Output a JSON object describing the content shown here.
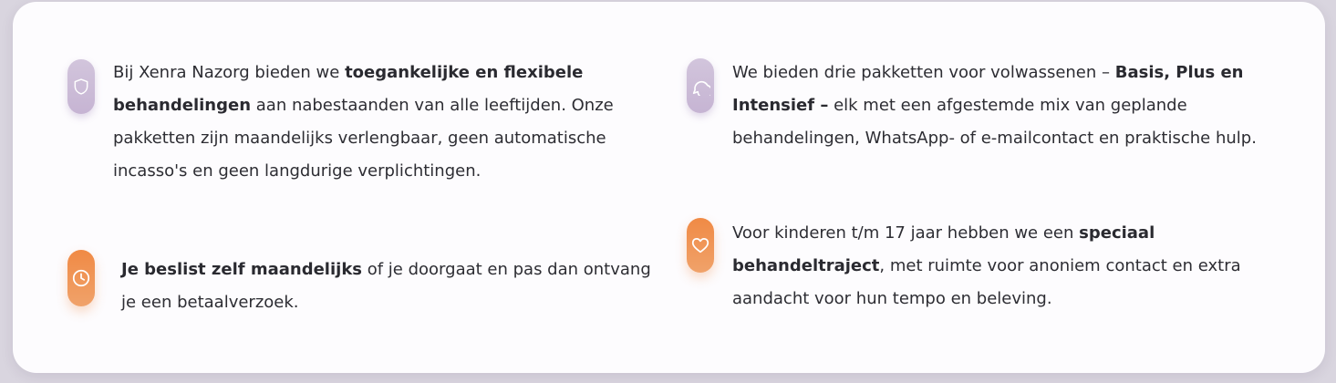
{
  "items": [
    {
      "icon": "shield-icon",
      "color": "purple",
      "t1": "Bij Xenra Nazorg bieden we ",
      "b1": "toegankelijke en flexibele behandelingen",
      "t2": " aan nabestaanden van alle leeftijden. Onze pakketten zijn maandelijks verlengbaar, geen automatische incasso's en geen langdurige verplichtingen."
    },
    {
      "icon": "clock-icon",
      "color": "orange",
      "b1": "Je beslist zelf maandelijks",
      "t2": " of je doorgaat en pas dan ontvang je een betaalverzoek."
    },
    {
      "icon": "chat-bubble-icon",
      "color": "purple",
      "t1": "We bieden drie pakketten voor volwassenen – ",
      "b1": "Basis, Plus en Intensief",
      "b2": " –",
      "t2": " elk met een afgestemde mix van geplande behandelingen, WhatsApp- of e-mailcontact en praktische hulp."
    },
    {
      "icon": "heart-icon",
      "color": "orange",
      "t1": "Voor kinderen t/m 17 jaar hebben we een ",
      "b1": "speciaal behandeltraject",
      "t2": ", met ruimte voor anoniem contact en extra aandacht voor hun tempo en beleving."
    }
  ],
  "colors": {
    "purple": "#c9b8d6",
    "orange": "#f08c48",
    "text": "#2d2d33",
    "card": "#fdfcfe"
  }
}
